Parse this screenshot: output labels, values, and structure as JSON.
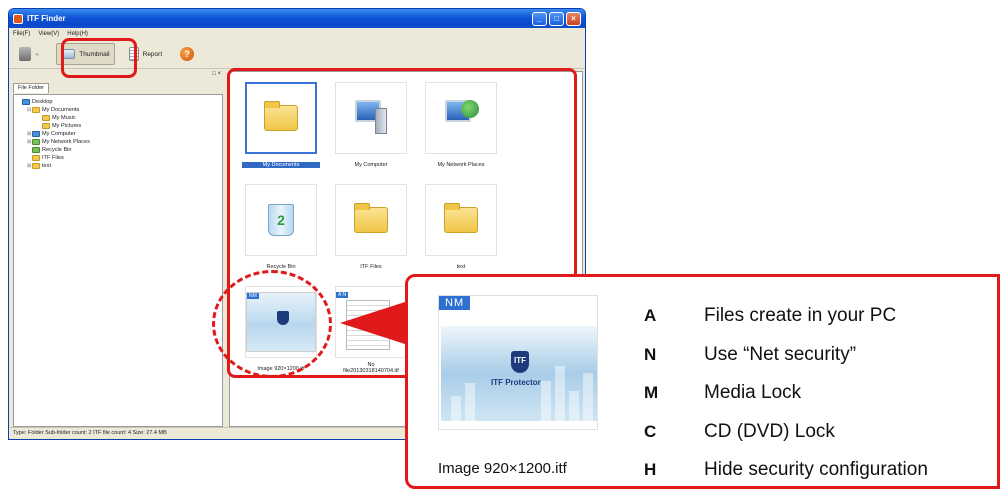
{
  "window": {
    "title": "ITF Finder",
    "menus": [
      "File(F)",
      "View(V)",
      "Help(H)"
    ],
    "toolbar": {
      "thumbnail": "Thumbnail",
      "report": "Report"
    }
  },
  "left_pane": {
    "tab": "File Folder",
    "tree": [
      {
        "label": "Desktop",
        "indent": 0,
        "icon": "desktop-icon"
      },
      {
        "label": "My Documents",
        "indent": 1,
        "icon": "folder-icon"
      },
      {
        "label": "My Music",
        "indent": 2,
        "icon": "folder-icon"
      },
      {
        "label": "My Pictures",
        "indent": 2,
        "icon": "folder-icon"
      },
      {
        "label": "My Computer",
        "indent": 1,
        "icon": "computer-icon"
      },
      {
        "label": "My Network Places",
        "indent": 1,
        "icon": "network-icon"
      },
      {
        "label": "Recycle Bin",
        "indent": 1,
        "icon": "recycle-bin-icon"
      },
      {
        "label": "ITF Files",
        "indent": 1,
        "icon": "folder-icon"
      },
      {
        "label": "text",
        "indent": 1,
        "icon": "folder-icon"
      }
    ]
  },
  "status": "Type: Folder Sub-folder count: 2 ITF file count: 4 Size: 27.4 MB",
  "items": [
    {
      "label": "My Documents",
      "kind": "folder-open",
      "selected": true
    },
    {
      "label": "My Computer",
      "kind": "computer",
      "selected": false
    },
    {
      "label": "My Network Places",
      "kind": "network",
      "selected": false
    },
    {
      "label": "Recycle Bin",
      "kind": "recycle",
      "selected": false
    },
    {
      "label": "ITF Files",
      "kind": "folder",
      "selected": false
    },
    {
      "label": "text",
      "kind": "folder",
      "selected": false
    },
    {
      "label": "Image 920×1200.itf",
      "kind": "image",
      "badge": "NM",
      "selected": false
    },
    {
      "label": "file20130318140704.itf",
      "kind": "doc",
      "badge": "A N",
      "label_prefix": "No",
      "selected": false
    }
  ],
  "legend": {
    "badge": "NM",
    "brand": "ITF Protector",
    "shield_text": "ITF",
    "filename": "Image 920×1200.itf",
    "rows": [
      {
        "key": "A",
        "desc": "Files create in your PC"
      },
      {
        "key": "N",
        "desc": "Use “Net security”"
      },
      {
        "key": "M",
        "desc": "Media Lock"
      },
      {
        "key": "C",
        "desc": "CD (DVD) Lock"
      },
      {
        "key": "H",
        "desc": "Hide security configuration"
      }
    ]
  },
  "colors": {
    "highlight_red": "#e01a1a",
    "title_blue": "#0a48c8",
    "badge_blue": "#2f6fd0"
  }
}
